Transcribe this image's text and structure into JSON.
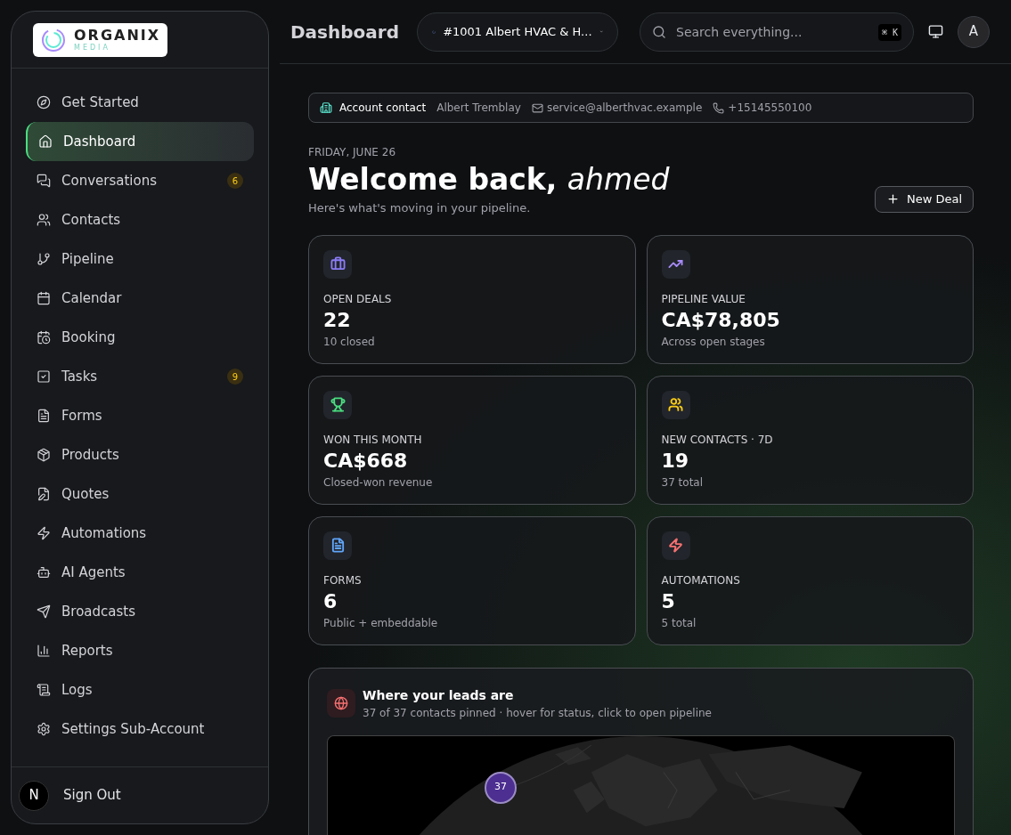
{
  "logo": {
    "name": "ORGANIX",
    "tagline": "MEDIA"
  },
  "sidebar": {
    "items": [
      {
        "label": "Get Started",
        "selected": false
      },
      {
        "label": "Dashboard",
        "selected": true
      },
      {
        "label": "Conversations",
        "selected": false,
        "badge": "6"
      },
      {
        "label": "Contacts",
        "selected": false
      },
      {
        "label": "Pipeline",
        "selected": false
      },
      {
        "label": "Calendar",
        "selected": false
      },
      {
        "label": "Booking",
        "selected": false
      },
      {
        "label": "Tasks",
        "selected": false,
        "badge": "9"
      },
      {
        "label": "Forms",
        "selected": false
      },
      {
        "label": "Products",
        "selected": false
      },
      {
        "label": "Quotes",
        "selected": false
      },
      {
        "label": "Automations",
        "selected": false
      },
      {
        "label": "AI Agents",
        "selected": false
      },
      {
        "label": "Broadcasts",
        "selected": false
      },
      {
        "label": "Reports",
        "selected": false
      },
      {
        "label": "Logs",
        "selected": false
      },
      {
        "label": "Settings Sub-Account",
        "selected": false
      }
    ],
    "avatar": "N",
    "sign_out": "Sign Out"
  },
  "header": {
    "title": "Dashboard",
    "account": "#1001 Albert HVAC & H...",
    "search": {
      "placeholder": "Search everything...",
      "shortcut": "⌘ K"
    },
    "user": "A"
  },
  "contact_bar": {
    "label": "Account contact",
    "name": "Albert Tremblay",
    "email": "service@alberthvac.example",
    "phone": "+15145550100"
  },
  "welcome": {
    "date": "FRIDAY, JUNE 26",
    "greeting": "Welcome back,",
    "user": "ahmed",
    "subtitle": "Here's what's moving in your pipeline.",
    "button": "New Deal"
  },
  "stats": [
    {
      "label": "OPEN DEALS",
      "value": "22",
      "note": "10 closed",
      "color": "#8b7cf6"
    },
    {
      "label": "PIPELINE VALUE",
      "value": "CA$78,805",
      "note": "Across open stages",
      "color": "#a78bfa"
    },
    {
      "label": "WON THIS MONTH",
      "value": "CA$668",
      "note": "Closed-won revenue",
      "color": "#4ade80"
    },
    {
      "label": "NEW CONTACTS · 7D",
      "value": "19",
      "note": "37 total",
      "color": "#facc15"
    },
    {
      "label": "FORMS",
      "value": "6",
      "note": "Public + embeddable",
      "color": "#60a5fa"
    },
    {
      "label": "AUTOMATIONS",
      "value": "5",
      "note": "5 total",
      "color": "#f87171"
    }
  ],
  "map": {
    "title": "Where your leads are",
    "subtitle": "37 of 37 contacts pinned · hover for status, click to open pipeline",
    "cluster": "37"
  }
}
